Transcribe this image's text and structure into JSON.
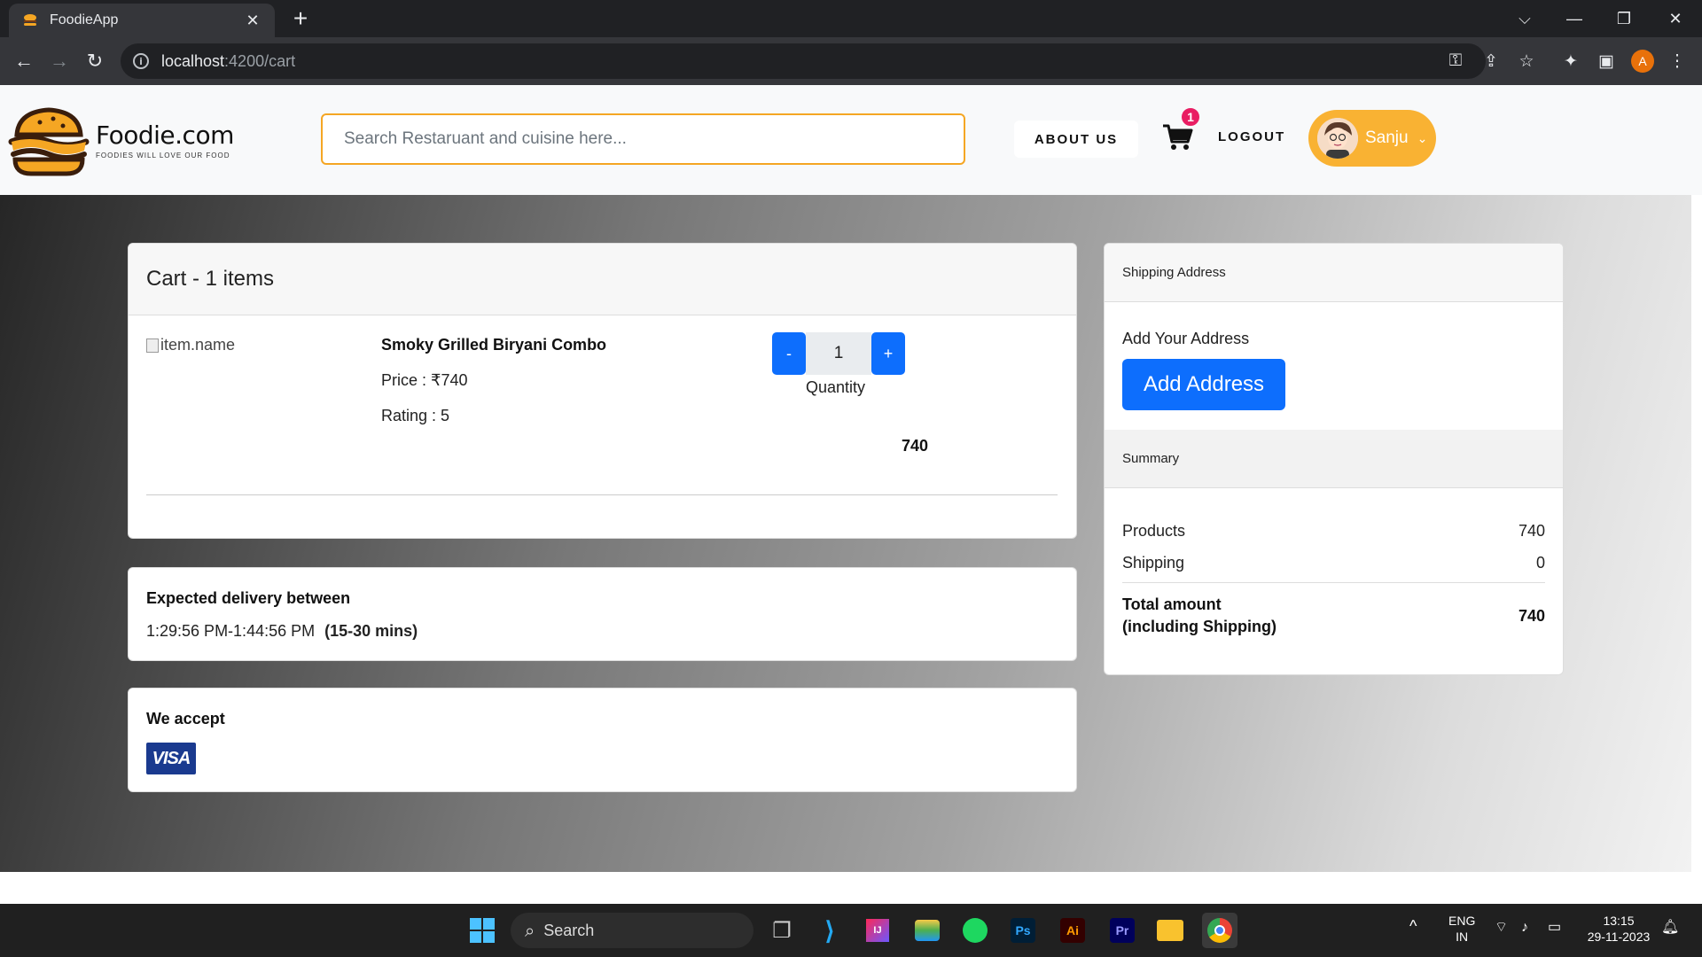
{
  "browser": {
    "tab_title": "FoodieApp",
    "url_host": "localhost",
    "url_path": ":4200/cart",
    "profile_initial": "A"
  },
  "header": {
    "brand_name": "Foodie.com",
    "brand_tagline": "FOODIES WILL LOVE OUR FOOD",
    "search_placeholder": "Search Restaruant and cuisine here...",
    "about_label": "ABOUT US",
    "cart_count": "1",
    "logout_label": "LOGOUT",
    "user_name": "Sanju"
  },
  "cart": {
    "title": "Cart - 1 items",
    "items": [
      {
        "image_alt": "item.name",
        "name": "Smoky Grilled Biryani Combo",
        "price": "Price : ₹740",
        "rating": "Rating : 5",
        "quantity": "1",
        "quantity_label": "Quantity",
        "line_total": "740",
        "decrement_label": "-",
        "increment_label": "+"
      }
    ]
  },
  "delivery": {
    "title": "Expected delivery between",
    "window": "1:29:56 PM-1:44:56 PM",
    "range": "(15-30 mins)"
  },
  "payment": {
    "title": "We accept",
    "card_brand": "VISA"
  },
  "shipping": {
    "header": "Shipping Address",
    "prompt": "Add Your Address",
    "button_label": "Add Address"
  },
  "summary": {
    "header": "Summary",
    "rows": [
      {
        "label": "Products",
        "value": "740"
      },
      {
        "label": "Shipping",
        "value": "0"
      }
    ],
    "total_label_line1": "Total amount",
    "total_label_line2": "(including Shipping)",
    "total_value": "740"
  },
  "taskbar": {
    "search_label": "Search",
    "lang": "ENG",
    "region": "IN",
    "time": "13:15",
    "date": "29-11-2023"
  },
  "colors": {
    "accent_orange": "#f5a623",
    "primary_blue": "#0d6efd",
    "badge_pink": "#e91e63"
  }
}
